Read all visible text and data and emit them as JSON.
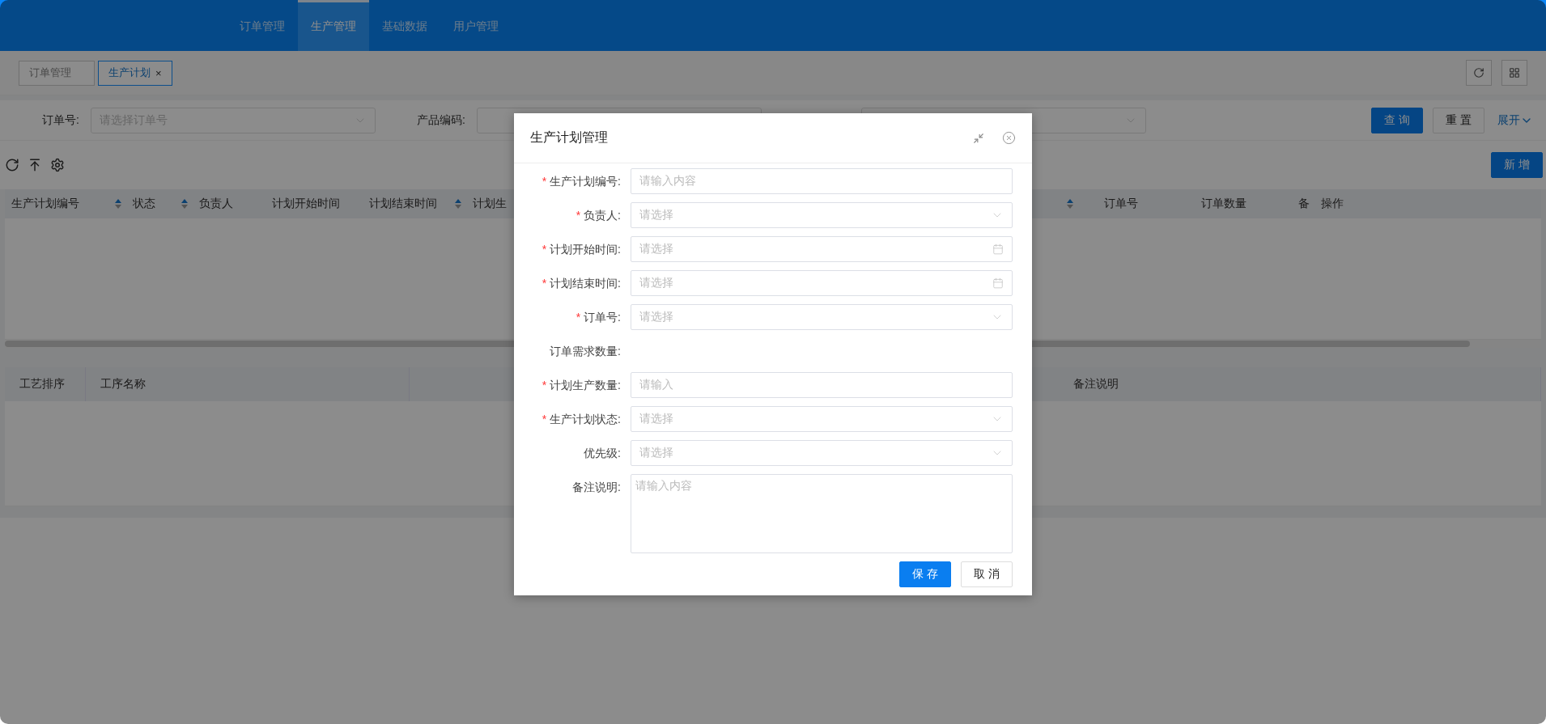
{
  "menu": [
    {
      "label": "订单管理",
      "selected": false
    },
    {
      "label": "生产管理",
      "selected": true
    },
    {
      "label": "基础数据",
      "selected": false
    },
    {
      "label": "用户管理",
      "selected": false
    }
  ],
  "tabs": [
    {
      "label": "订单管理",
      "selected": false,
      "closable": false
    },
    {
      "label": "生产计划",
      "selected": true,
      "closable": true
    }
  ],
  "tab_close": "×",
  "filters": [
    {
      "kind": "select",
      "label": "订单号:",
      "placeholder": "请选择订单号",
      "caret": true
    },
    {
      "kind": "select",
      "label": "产品编码:",
      "caret": false
    },
    {
      "kind": "select",
      "caret": true
    }
  ],
  "filter_buttons": [
    {
      "label": "查 询",
      "kind": "primary"
    },
    {
      "label": "重 置",
      "kind": "default"
    }
  ],
  "expand_link": "展开",
  "add_button": "新 增",
  "plan_table": {
    "columns": [
      {
        "label": "生产计划编号",
        "sortable": true
      },
      {
        "label": "状态",
        "sortable": true
      },
      {
        "label": "负责人",
        "sortable": false
      },
      {
        "label": "计划开始时间",
        "sortable": false
      },
      {
        "label": "计划结束时间",
        "sortable": true
      },
      {
        "label": "计划生",
        "sortable": false
      }
    ],
    "right_columns": [
      {
        "label": "订单号",
        "sortable": false
      },
      {
        "label": "订单数量",
        "sortable": false
      },
      {
        "label": "备",
        "sortable": false
      },
      {
        "label": "操作",
        "sortable": false
      }
    ]
  },
  "process_table": {
    "columns": [
      {
        "label": "工艺排序"
      },
      {
        "label": "工序名称"
      }
    ],
    "right_columns": [
      {
        "label": "备注说明"
      }
    ]
  },
  "dialog": {
    "title": "生产计划管理",
    "fields": [
      {
        "label": "生产计划编号:",
        "required": true,
        "kind": "text",
        "placeholder": "请输入内容"
      },
      {
        "label": "负责人:",
        "required": true,
        "kind": "select",
        "placeholder": "请选择"
      },
      {
        "label": "计划开始时间:",
        "required": true,
        "kind": "date",
        "placeholder": "请选择"
      },
      {
        "label": "计划结束时间:",
        "required": true,
        "kind": "date",
        "placeholder": "请选择"
      },
      {
        "label": "订单号:",
        "required": true,
        "kind": "select",
        "placeholder": "请选择"
      },
      {
        "label": "订单需求数量:",
        "required": false,
        "kind": "static"
      },
      {
        "label": "计划生产数量:",
        "required": true,
        "kind": "text",
        "placeholder": "请输入"
      },
      {
        "label": "生产计划状态:",
        "required": true,
        "kind": "select",
        "placeholder": "请选择"
      },
      {
        "label": "优先级:",
        "required": false,
        "kind": "select",
        "placeholder": "请选择"
      },
      {
        "label": "备注说明:",
        "required": false,
        "kind": "textarea",
        "placeholder": "请输入内容"
      }
    ],
    "required_mark": "*",
    "buttons": [
      {
        "label": "保 存",
        "kind": "primary"
      },
      {
        "label": "取 消",
        "kind": "default"
      }
    ]
  }
}
